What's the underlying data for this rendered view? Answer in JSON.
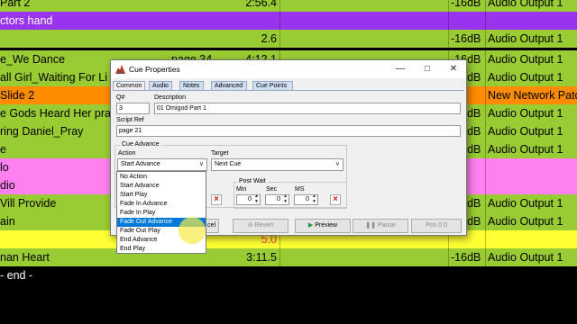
{
  "cue_list": {
    "rows": [
      {
        "name": "Part 2",
        "page": "",
        "time": "2:56.4",
        "level": "-16dB",
        "output": "Audio Output 1",
        "bg": "#99cc33"
      },
      {
        "name": "ctors hand",
        "page": "",
        "time": "",
        "level": "",
        "output": "",
        "bg": "#9933ee",
        "fg": "#ffffff"
      },
      {
        "name": "",
        "page": "",
        "time": "2.6",
        "level": "-16dB",
        "output": "Audio Output 1",
        "bg": "#99cc33"
      },
      {
        "name": "e_We Dance",
        "page": "page 34",
        "time": "4:12.1",
        "level": "-16dB",
        "output": "Audio Output 1",
        "bg": "#99cc33"
      },
      {
        "name": "all Girl_Waiting For Li",
        "page": "",
        "time": "",
        "level": "-16dB",
        "output": "Audio Output 1",
        "bg": "#99cc33"
      },
      {
        "name": "Slide 2",
        "page": "",
        "time": "",
        "level": "",
        "output": "New Network Patc",
        "bg": "#ff8c00"
      },
      {
        "name": "e Gods Heard Her pray",
        "page": "",
        "time": "",
        "level": "-16dB",
        "output": "Audio Output 1",
        "bg": "#99cc33"
      },
      {
        "name": "ring Daniel_Pray",
        "page": "",
        "time": "",
        "level": "-16dB",
        "output": "Audio Output 1",
        "bg": "#99cc33"
      },
      {
        "name": "e",
        "page": "",
        "time": "",
        "level": "-16dB",
        "output": "Audio Output 1",
        "bg": "#99cc33"
      },
      {
        "name": "lo",
        "page": "",
        "time": "",
        "level": "",
        "output": "",
        "bg": "#ff80ee"
      },
      {
        "name": "dio",
        "page": "",
        "time": "",
        "level": "",
        "output": "",
        "bg": "#ff80ee"
      },
      {
        "name": "Vill Provide",
        "page": "",
        "time": "",
        "level": "-16dB",
        "output": "Audio Output 1",
        "bg": "#99cc33"
      },
      {
        "name": "ain",
        "page": "",
        "time": "",
        "level": "-16dB",
        "output": "Audio Output 1",
        "bg": "#99cc33"
      },
      {
        "name": "",
        "page": "",
        "time": "5.0",
        "level": "",
        "output": "",
        "bg": "#ffff33",
        "time_color": "#ff3b3b"
      },
      {
        "name": "nan Heart",
        "page": "",
        "time": "3:11.5",
        "level": "-16dB",
        "output": "Audio Output 1",
        "bg": "#99cc33"
      },
      {
        "name": "- end -",
        "page": "",
        "time": "",
        "level": "",
        "output": "",
        "bg": "#000000",
        "fg": "#ffffff"
      }
    ]
  },
  "dialog": {
    "title": "Cue Properties",
    "tabs": [
      "Common",
      "Audio",
      "Notes",
      "Advanced",
      "Cue Points"
    ],
    "active_tab": "Common",
    "number_label": "Q#",
    "number_value": "3",
    "description_label": "Description",
    "description_value": "01 Omigod Part 1",
    "script_ref_label": "Script Ref",
    "script_ref_value": "page 21",
    "cue_advance_label": "Cue Advance",
    "action_label": "Action",
    "action_value": "Start Advance",
    "target_label": "Target",
    "target_value": "Next Cue",
    "post_wait_label": "Post Wait",
    "min_label": "Min",
    "sec_label": "Sec",
    "ms_label": "MS",
    "min_value": "0",
    "sec_value": "0",
    "ms_value": "0",
    "cancel_label": "cel",
    "revert_label": "Revert",
    "preview_label": "Preview",
    "pause_label": "Pause",
    "pos_label": "Pos 0.0"
  },
  "action_dropdown": {
    "options": [
      "No Action",
      "Start Advance",
      "Start Play",
      "Fade In Advance",
      "Fade In Play",
      "Fade Out Advance",
      "Fade Out Play",
      "End Advance",
      "End Play"
    ],
    "highlighted": "Fade Out Advance"
  },
  "icons": {
    "app": "app-logo-icon",
    "minimize": "minimize-icon",
    "maximize": "maximize-icon",
    "close": "close-icon",
    "dropdown": "chevron-down-icon",
    "clear": "clear-x-icon",
    "play": "play-icon",
    "pause": "pause-icon"
  }
}
